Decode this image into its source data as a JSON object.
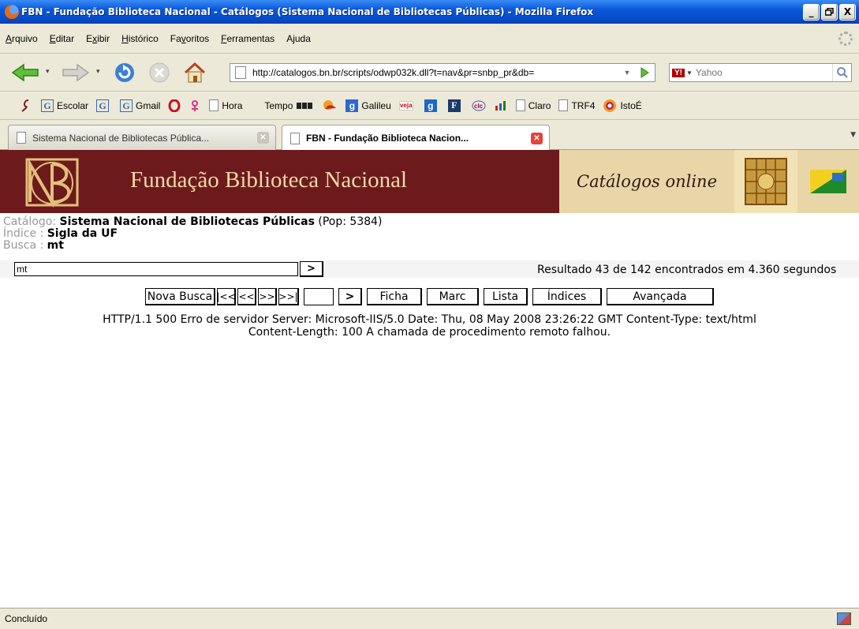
{
  "window": {
    "title": "FBN - Fundação Biblioteca Nacional - Catálogos (Sistema Nacional de Bibliotecas Públicas) - Mozilla Firefox",
    "minimize": "_",
    "maximize": "»",
    "close": "X"
  },
  "menu": [
    "Arquivo",
    "Editar",
    "Exibir",
    "Histórico",
    "Favoritos",
    "Ferramentas",
    "Ajuda"
  ],
  "menu_underline": [
    "A",
    "E",
    "x",
    "H",
    "v",
    "F",
    "j"
  ],
  "nav": {
    "url": "http://catalogos.bn.br/scripts/odwp032k.dll?t=nav&pr=snbp_pr&db=",
    "search_placeholder": "Yahoo",
    "search_engine": "Y!"
  },
  "bookmarks": [
    "Escolar",
    "Gmail",
    "Hora",
    "Tempo",
    "Galileu",
    "Claro",
    "TRF4",
    "IstoÉ"
  ],
  "tabs": [
    {
      "label": "Sistema Nacional de Bibliotecas Pública...",
      "active": false
    },
    {
      "label": "FBN - Fundação Biblioteca Nacion...",
      "active": true
    }
  ],
  "banner": {
    "name": "Fundação Biblioteca Nacional",
    "catalogs": "Catálogos online"
  },
  "info": {
    "catalog_label": "Catálogo:",
    "catalog_value": "Sistema Nacional de Bibliotecas Públicas",
    "catalog_pop": "(Pop: 5384)",
    "index_label": "Índice :",
    "index_value": "Sigla da UF",
    "search_label": "Busca :",
    "search_value": "mt"
  },
  "search": {
    "query": "mt",
    "go": ">",
    "result": "Resultado 43 de 142 encontrados em 4.360 segundos"
  },
  "buttons": {
    "new_search": "Nova Busca",
    "first": "|<<",
    "prev": "<<",
    "next": ">>",
    "last": ">>|",
    "go_page": ">",
    "ficha": "Ficha",
    "marc": "Marc",
    "lista": "Lista",
    "indices": "Índices",
    "avancada": "Avançada"
  },
  "error_line1": "HTTP/1.1 500 Erro de servidor Server: Microsoft-IIS/5.0 Date: Thu, 08 May 2008 23:26:22 GMT Content-Type: text/html",
  "error_line2": "Content-Length: 100 A chamada de procedimento remoto falhou.",
  "status": "Concluído",
  "colors": {
    "banner_bg": "#6d1a1d",
    "banner_text": "#f1d9a8",
    "titlebar": "#0a58d8"
  }
}
